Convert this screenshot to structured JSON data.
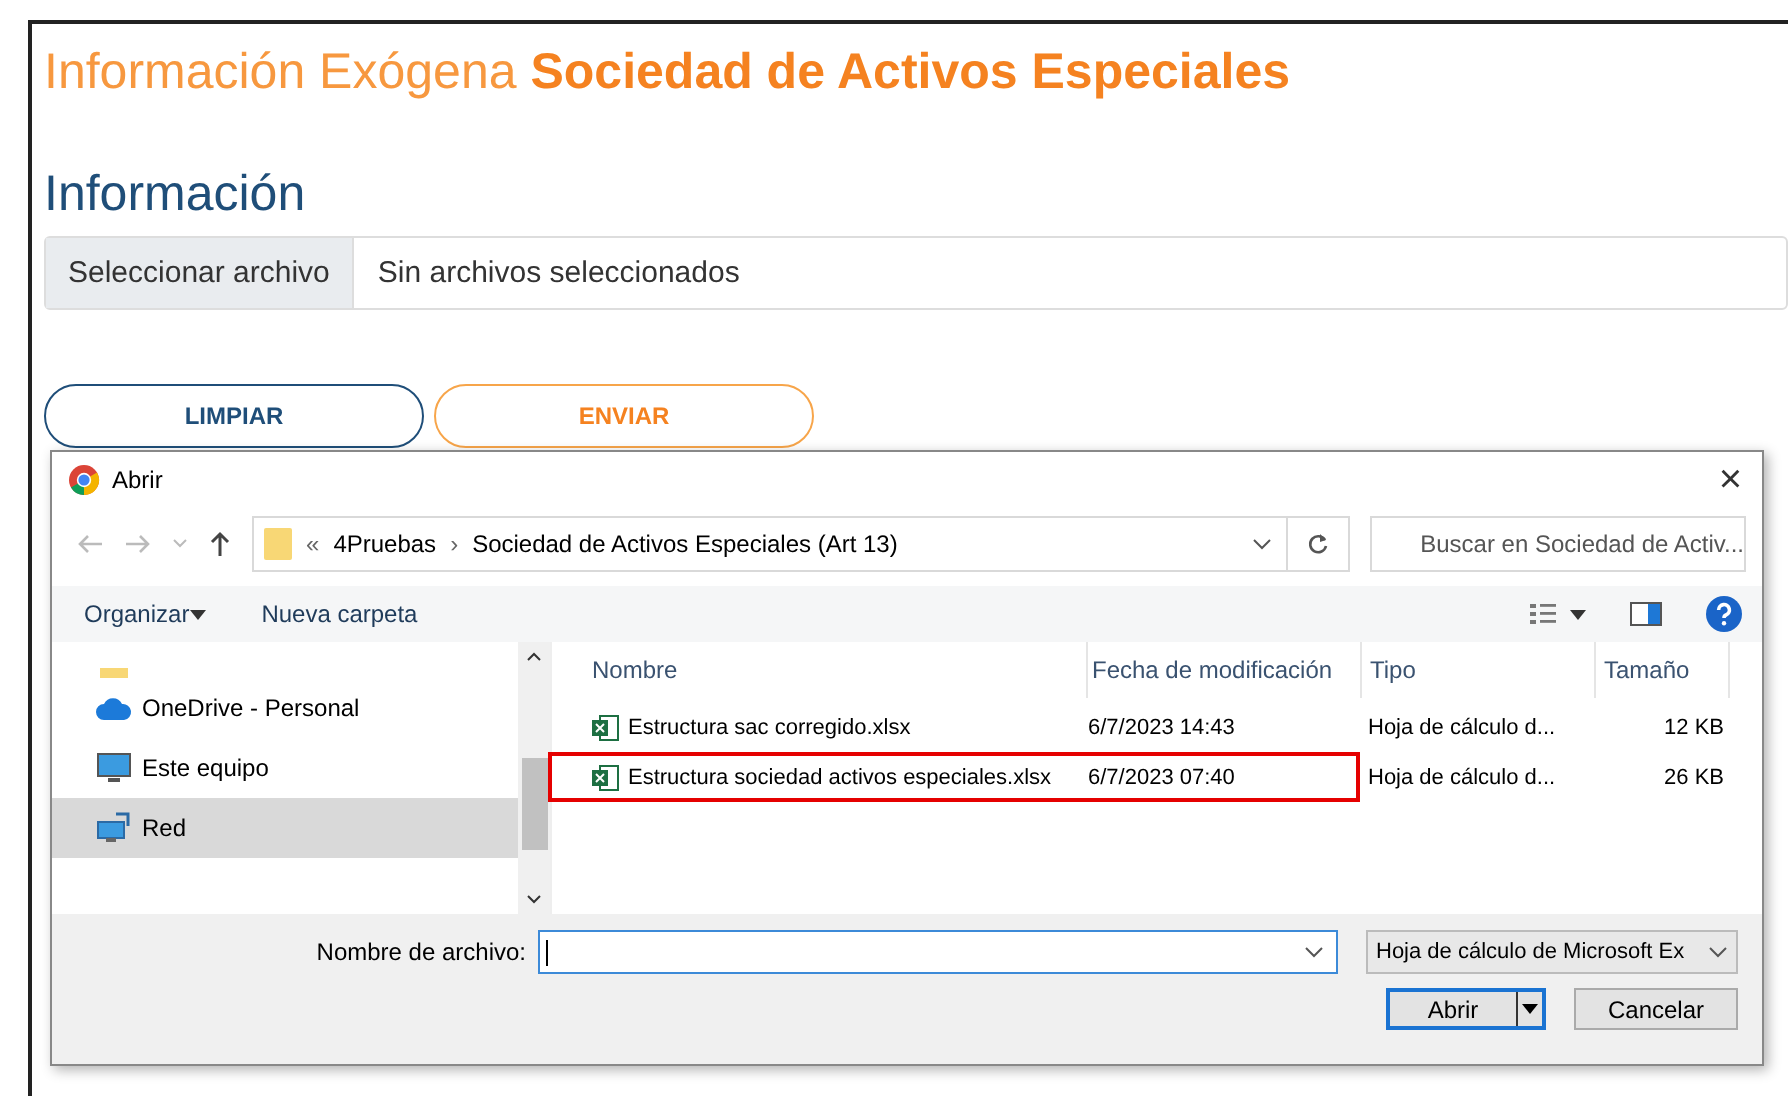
{
  "header": {
    "title_light": "Información Exógena",
    "title_bold": "Sociedad de Activos Especiales"
  },
  "section_title": "Información",
  "file_input": {
    "button": "Seleccionar archivo",
    "value": "Sin archivos seleccionados"
  },
  "buttons": [
    {
      "label": "LIMPIAR",
      "kind": "primary"
    },
    {
      "label": "ENVIAR",
      "kind": "accent"
    }
  ],
  "dialog": {
    "title": "Abrir",
    "close": "×",
    "breadcrumb_more": "«",
    "breadcrumb_sep": "›",
    "breadcrumb": [
      "4Pruebas",
      "Sociedad de Activos Especiales (Art 13)"
    ],
    "search": {
      "placeholder": "Buscar en Sociedad de Activ..."
    },
    "toolbar": [
      "Organizar",
      "Nueva carpeta"
    ],
    "sidebar": [
      {
        "label": "OneDrive - Personal",
        "kind": "cloud",
        "selected": false
      },
      {
        "label": "Este equipo",
        "kind": "computer",
        "selected": false
      },
      {
        "label": "Red",
        "kind": "network",
        "selected": true
      }
    ],
    "columns": [
      "Nombre",
      "Fecha de modificación",
      "Tipo",
      "Tamaño"
    ],
    "files": [
      {
        "name": "Estructura sac corregido.xlsx",
        "date": "6/7/2023 14:43",
        "type": "Hoja de cálculo d...",
        "size": "12 KB",
        "highlighted": false
      },
      {
        "name": "Estructura sociedad activos especiales.xlsx",
        "date": "6/7/2023 07:40",
        "type": "Hoja de cálculo d...",
        "size": "26 KB",
        "highlighted": true
      }
    ],
    "filename_label": "Nombre de archivo:",
    "filter": "Hoja de cálculo de Microsoft Ex",
    "open": "Abrir",
    "cancel": "Cancelar"
  }
}
